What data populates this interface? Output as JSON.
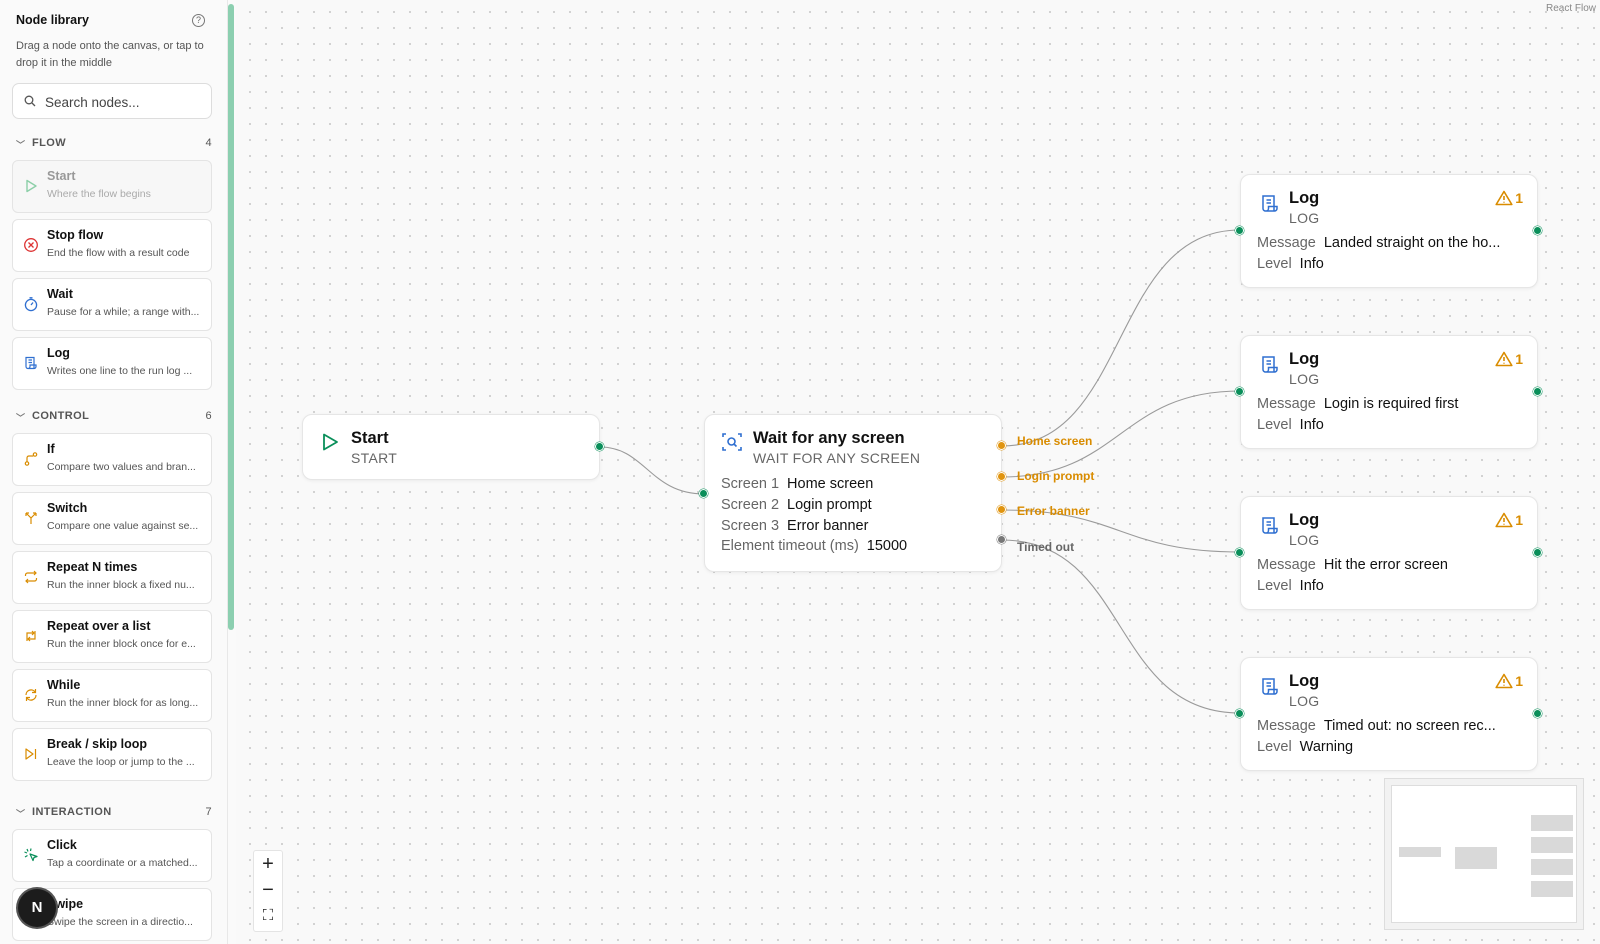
{
  "sidebar": {
    "title": "Node library",
    "help_icon": "?",
    "subtitle": "Drag a node onto the canvas, or tap to drop it in the middle",
    "search_placeholder": "Search nodes...",
    "sections": [
      {
        "name": "FLOW",
        "count": "4",
        "items": [
          {
            "title": "Start",
            "desc": "Where the flow begins",
            "icon": "play-icon",
            "disabled": true
          },
          {
            "title": "Stop flow",
            "desc": "End the flow with a result code",
            "icon": "stop-circle-icon"
          },
          {
            "title": "Wait",
            "desc": "Pause for a while; a range with...",
            "icon": "timer-icon"
          },
          {
            "title": "Log",
            "desc": "Writes one line to the run log ...",
            "icon": "scroll-icon"
          }
        ]
      },
      {
        "name": "CONTROL",
        "count": "6",
        "items": [
          {
            "title": "If",
            "desc": "Compare two values and bran...",
            "icon": "branch-icon"
          },
          {
            "title": "Switch",
            "desc": "Compare one value against se...",
            "icon": "split-icon"
          },
          {
            "title": "Repeat N times",
            "desc": "Run the inner block a fixed nu...",
            "icon": "repeat-icon"
          },
          {
            "title": "Repeat over a list",
            "desc": "Run the inner block once for e...",
            "icon": "repeat-list-icon"
          },
          {
            "title": "While",
            "desc": "Run the inner block for as long...",
            "icon": "loop-icon"
          },
          {
            "title": "Break / skip loop",
            "desc": "Leave the loop or jump to the ...",
            "icon": "skip-icon"
          }
        ]
      },
      {
        "name": "INTERACTION",
        "count": "7",
        "items": [
          {
            "title": "Click",
            "desc": "Tap a coordinate or a matched...",
            "icon": "click-icon"
          },
          {
            "title": "Swipe",
            "desc": "Swipe the screen in a directio...",
            "icon": "swipe-icon"
          }
        ]
      }
    ]
  },
  "avatar": "N",
  "canvas": {
    "attribution": "React Flow",
    "nodes": {
      "start": {
        "title": "Start",
        "subtitle": "START"
      },
      "wait": {
        "title": "Wait for any screen",
        "subtitle": "WAIT FOR ANY SCREEN",
        "rows": [
          {
            "k": "Screen 1",
            "v": "Home screen"
          },
          {
            "k": "Screen 2",
            "v": "Login prompt"
          },
          {
            "k": "Screen 3",
            "v": "Error banner"
          },
          {
            "k": "Element timeout (ms)",
            "v": "15000"
          }
        ],
        "outputs": [
          "Home screen",
          "Login prompt",
          "Error banner",
          "Timed out"
        ]
      },
      "logs": [
        {
          "title": "Log",
          "subtitle": "LOG",
          "warnings": "1",
          "message_label": "Message",
          "message": "Landed straight on the ho...",
          "level_label": "Level",
          "level": "Info"
        },
        {
          "title": "Log",
          "subtitle": "LOG",
          "warnings": "1",
          "message_label": "Message",
          "message": "Login is required first",
          "level_label": "Level",
          "level": "Info"
        },
        {
          "title": "Log",
          "subtitle": "LOG",
          "warnings": "1",
          "message_label": "Message",
          "message": "Hit the error screen",
          "level_label": "Level",
          "level": "Info"
        },
        {
          "title": "Log",
          "subtitle": "LOG",
          "warnings": "1",
          "message_label": "Message",
          "message": "Timed out: no screen rec...",
          "level_label": "Level",
          "level": "Warning"
        }
      ]
    },
    "controls": {
      "zoom_in": "+",
      "zoom_out": "−",
      "fit": "⛶"
    },
    "colors": {
      "accent_green": "#0a8f5a",
      "warning_orange": "#d98c00",
      "scroll_green": "#8ccfb0"
    }
  }
}
